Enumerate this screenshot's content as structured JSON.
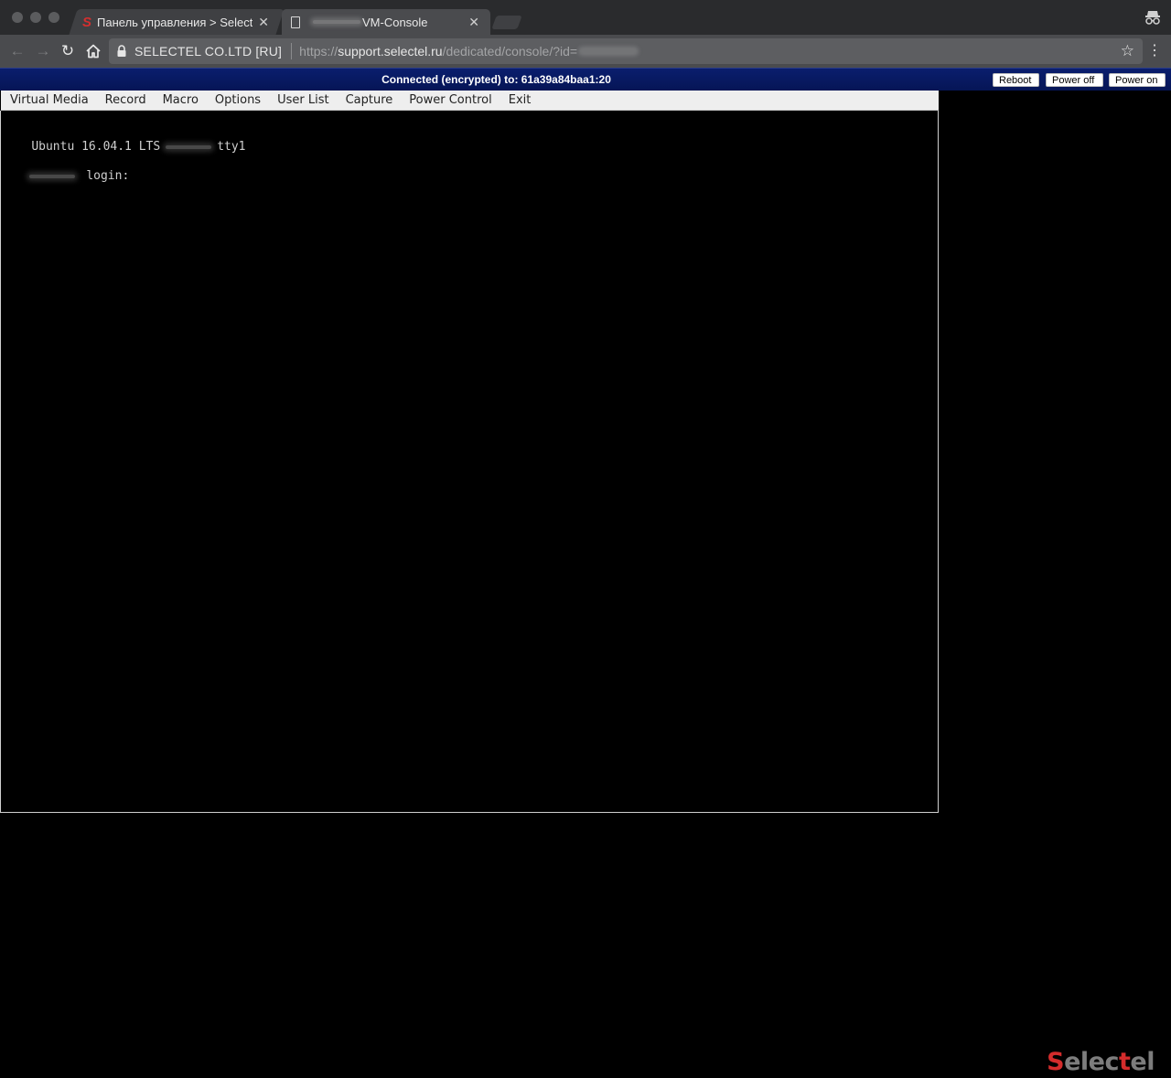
{
  "browser": {
    "tabs": [
      {
        "title": "Панель управления > Selecte",
        "favicon": "selectel-s-icon",
        "active": false
      },
      {
        "title": "VM-Console",
        "favicon": "document-icon",
        "active": true
      }
    ],
    "address_bar": {
      "site_identity": "SELECTEL CO.LTD [RU]",
      "url_scheme": "https://",
      "url_host": "support.selectel.ru",
      "url_path": "/dedicated/console/?id="
    }
  },
  "kvm": {
    "status": "Connected (encrypted) to: 61a39a84baa1:20",
    "buttons": {
      "reboot": "Reboot",
      "power_off": "Power off",
      "power_on": "Power on"
    },
    "menu": [
      "Virtual Media",
      "Record",
      "Macro",
      "Options",
      "User List",
      "Capture",
      "Power Control",
      "Exit"
    ],
    "console": {
      "line1_prefix": "Ubuntu 16.04.1 LTS",
      "line1_suffix": "tty1",
      "line2": "login:"
    }
  },
  "logo": {
    "red": "S",
    "grey1": "elec",
    "red2": "t",
    "grey2": "el"
  },
  "colors": {
    "header_blue": "#0a1e6e",
    "brand_red": "#d42c2c",
    "menubar": "#eeeeee"
  }
}
